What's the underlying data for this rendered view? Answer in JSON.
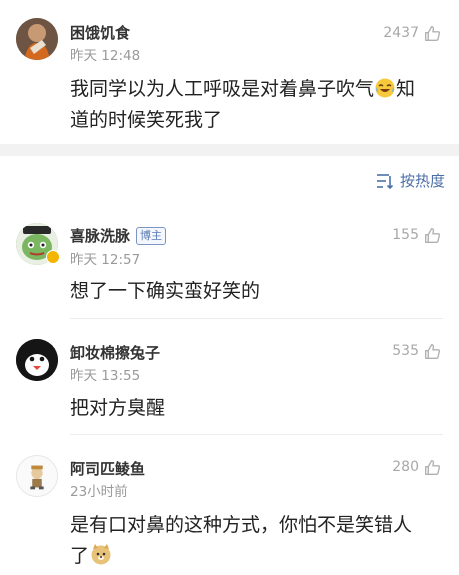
{
  "comments": [
    {
      "username": "困饿饥食",
      "time": "昨天 12:48",
      "likes": "2437",
      "text_line1": "我同学以为人工呼吸是对着鼻子吹气",
      "text_line1_tail": "知",
      "text_line2": "道的时候笑死我了",
      "emoji_icon": "laughing-tears-emoji-icon"
    },
    {
      "username": "喜脉洗脉",
      "badge": "博主",
      "time": "昨天 12:57",
      "likes": "155",
      "text": "想了一下确实蛮好笑的"
    },
    {
      "username": "卸妆棉擦兔子",
      "time": "昨天 13:55",
      "likes": "535",
      "text": "把对方臭醒"
    },
    {
      "username": "阿司匹鲮鱼",
      "time": "23小时前",
      "likes": "280",
      "text_line1": "是有口对鼻的这种方式，你怕不是笑错人",
      "text_line2": "了",
      "emoji_icon": "doge-emoji-icon"
    }
  ],
  "sort": {
    "label": "按热度",
    "icon": "sort-icon"
  },
  "colors": {
    "accent": "#4c6fa8",
    "muted": "#9a9a9a",
    "band": "#f2f2f2"
  }
}
